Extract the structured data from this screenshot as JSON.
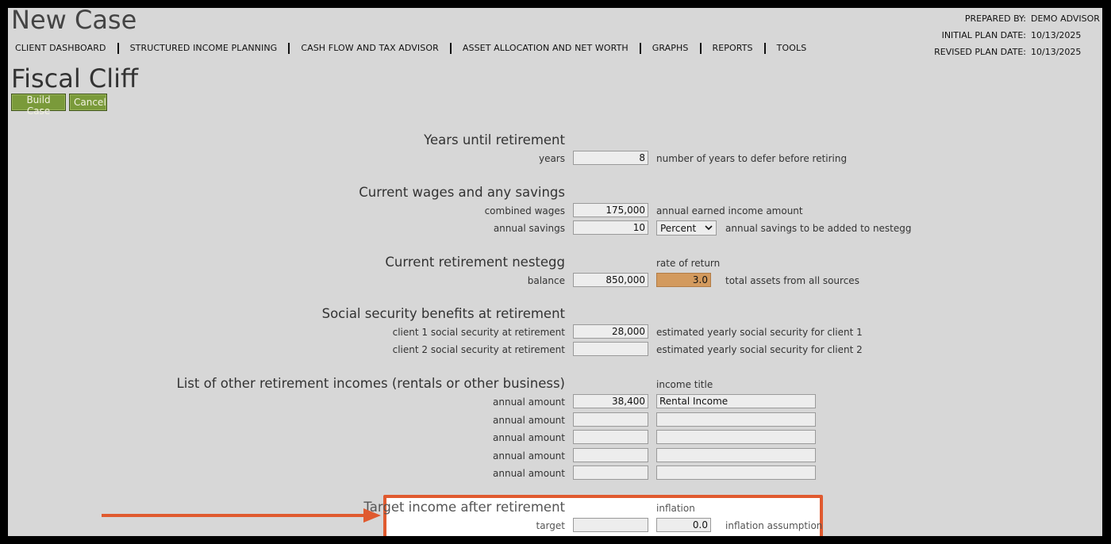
{
  "header": {
    "app_title": "New Case",
    "nav": [
      "CLIENT DASHBOARD",
      "STRUCTURED INCOME PLANNING",
      "CASH FLOW AND TAX ADVISOR",
      "ASSET ALLOCATION AND NET WORTH",
      "GRAPHS",
      "REPORTS",
      "TOOLS"
    ],
    "meta": [
      {
        "label": "PREPARED BY:",
        "value": "DEMO ADVISOR"
      },
      {
        "label": "INITIAL PLAN DATE:",
        "value": "10/13/2025"
      },
      {
        "label": "REVISED PLAN DATE:",
        "value": "10/13/2025"
      }
    ]
  },
  "case": {
    "title": "Fiscal Cliff",
    "build_label": "Build Case",
    "cancel_label": "Cancel"
  },
  "years": {
    "heading": "Years until retirement",
    "label": "years",
    "value": "8",
    "hint": "number of years to defer before retiring"
  },
  "wages": {
    "heading": "Current wages and any savings",
    "combined_label": "combined wages",
    "combined_value": "175,000",
    "combined_hint": "annual earned income amount",
    "savings_label": "annual savings",
    "savings_value": "10",
    "savings_unit": "Percent",
    "savings_hint": "annual savings to be added to nestegg"
  },
  "nestegg": {
    "heading": "Current retirement nestegg",
    "rate_head": "rate of return",
    "balance_label": "balance",
    "balance_value": "850,000",
    "rate_value": "3.0",
    "hint": "total assets from all sources"
  },
  "social": {
    "heading": "Social security benefits at retirement",
    "c1_label": "client 1 social security at retirement",
    "c1_value": "28,000",
    "c1_hint": "estimated yearly social security for client 1",
    "c2_label": "client 2 social security at retirement",
    "c2_value": "",
    "c2_hint": "estimated yearly social security for client 2"
  },
  "other": {
    "heading": "List of other retirement incomes (rentals or other business)",
    "title_head": "income title",
    "rows": [
      {
        "label": "annual amount",
        "amount": "38,400",
        "title": "Rental Income"
      },
      {
        "label": "annual amount",
        "amount": "",
        "title": ""
      },
      {
        "label": "annual amount",
        "amount": "",
        "title": ""
      },
      {
        "label": "annual amount",
        "amount": "",
        "title": ""
      },
      {
        "label": "annual amount",
        "amount": "",
        "title": ""
      }
    ]
  },
  "target": {
    "heading": "Target income after retirement",
    "inflation_head": "inflation",
    "label": "target",
    "value": "",
    "inflation_value": "0.0",
    "inflation_hint": "inflation assumption"
  },
  "colors": {
    "highlight": "#e05a2f",
    "button": "#7a9a3a",
    "rate_field": "#d39a5e"
  }
}
